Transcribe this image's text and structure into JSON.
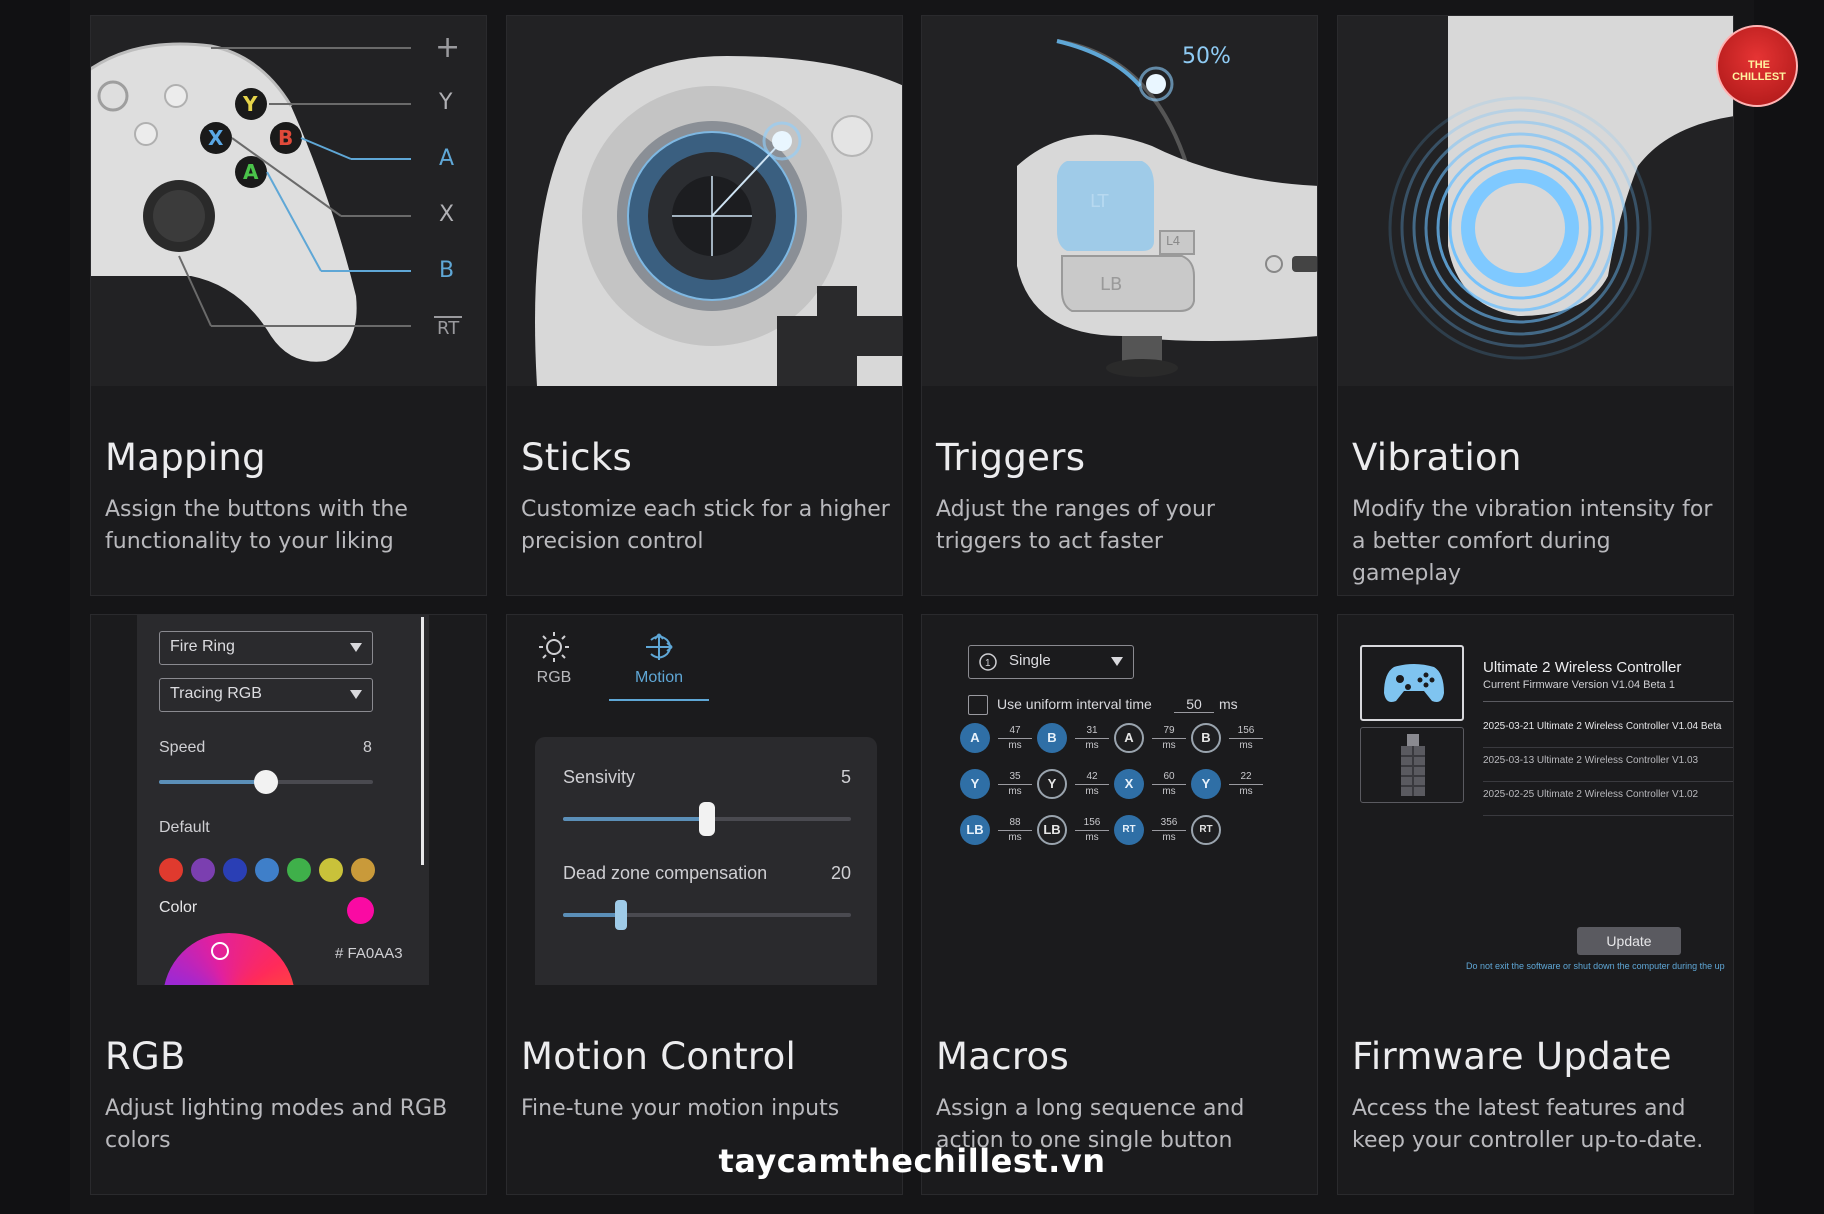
{
  "cards": [
    {
      "title": "Mapping",
      "desc": "Assign the buttons with the functionality to your liking"
    },
    {
      "title": "Sticks",
      "desc": "Customize each stick for a higher precision control"
    },
    {
      "title": "Triggers",
      "desc": "Adjust the ranges of your triggers to act faster"
    },
    {
      "title": "Vibration",
      "desc": "Modify the vibration intensity for a better comfort during gameplay"
    },
    {
      "title": "RGB",
      "desc": "Adjust lighting modes and RGB colors"
    },
    {
      "title": "Motion Control",
      "desc": "Fine-tune your motion inputs"
    },
    {
      "title": "Macros",
      "desc": "Assign a long sequence and action to one single button"
    },
    {
      "title": "Firmware Update",
      "desc": "Access the latest features and keep your controller up-to-date."
    }
  ],
  "mapping": {
    "labels": [
      "+",
      "Y",
      "A",
      "X",
      "B",
      "RT"
    ],
    "buttons": [
      "Y",
      "X",
      "B",
      "A"
    ]
  },
  "triggers": {
    "percent": "50%",
    "lt": "LT",
    "lb": "LB",
    "l4": "L4"
  },
  "rgb": {
    "mode1": "Fire Ring",
    "mode2": "Tracing RGB",
    "speed_label": "Speed",
    "speed_value": "8",
    "speed_fraction": 0.5,
    "default_label": "Default",
    "swatches": [
      "#e03a2e",
      "#7b3fb0",
      "#2a3fb5",
      "#3f7fc9",
      "#3fb04a",
      "#c9c23a",
      "#c99a3a"
    ],
    "color_label": "Color",
    "current_color": "#FA0AA3",
    "hex_label": "# FA0AA3"
  },
  "motion": {
    "tab_rgb": "RGB",
    "tab_motion": "Motion",
    "sens_label": "Sensivity",
    "sens_value": "5",
    "sens_fraction": 0.5,
    "dz_label": "Dead zone compensation",
    "dz_value": "20",
    "dz_fraction": 0.2
  },
  "macros": {
    "mode": "Single",
    "interval_label": "Use uniform interval time",
    "interval_value": "50",
    "interval_unit": "ms",
    "rows": [
      [
        {
          "k": "A",
          "t": "f",
          "ms": "47"
        },
        {
          "k": "B",
          "t": "f",
          "ms": "31"
        },
        {
          "k": "A",
          "t": "o",
          "ms": "79"
        },
        {
          "k": "B",
          "t": "o",
          "ms": "156"
        }
      ],
      [
        {
          "k": "Y",
          "t": "f",
          "ms": "35"
        },
        {
          "k": "Y",
          "t": "o",
          "ms": "42"
        },
        {
          "k": "X",
          "t": "f",
          "ms": "60"
        },
        {
          "k": "Y",
          "t": "f",
          "ms": "22"
        }
      ],
      [
        {
          "k": "LB",
          "t": "f",
          "ms": "88"
        },
        {
          "k": "LB",
          "t": "o",
          "ms": "156"
        },
        {
          "k": "RT",
          "t": "f",
          "ms": "356"
        },
        {
          "k": "RT",
          "t": "o",
          "ms": ""
        }
      ]
    ],
    "unit": "ms"
  },
  "firmware": {
    "device": "Ultimate 2 Wireless Controller",
    "current": "Current Firmware Version V1.04 Beta 1",
    "history": [
      "2025-03-21 Ultimate 2 Wireless Controller V1.04 Beta",
      "2025-03-13 Ultimate 2 Wireless Controller V1.03",
      "2025-02-25 Ultimate 2 Wireless Controller V1.02"
    ],
    "update": "Update",
    "warning": "Do not exit the software or shut down the computer during the up"
  },
  "watermark": "taycamthechillest.vn",
  "logo_text": "THE CHILLEST"
}
